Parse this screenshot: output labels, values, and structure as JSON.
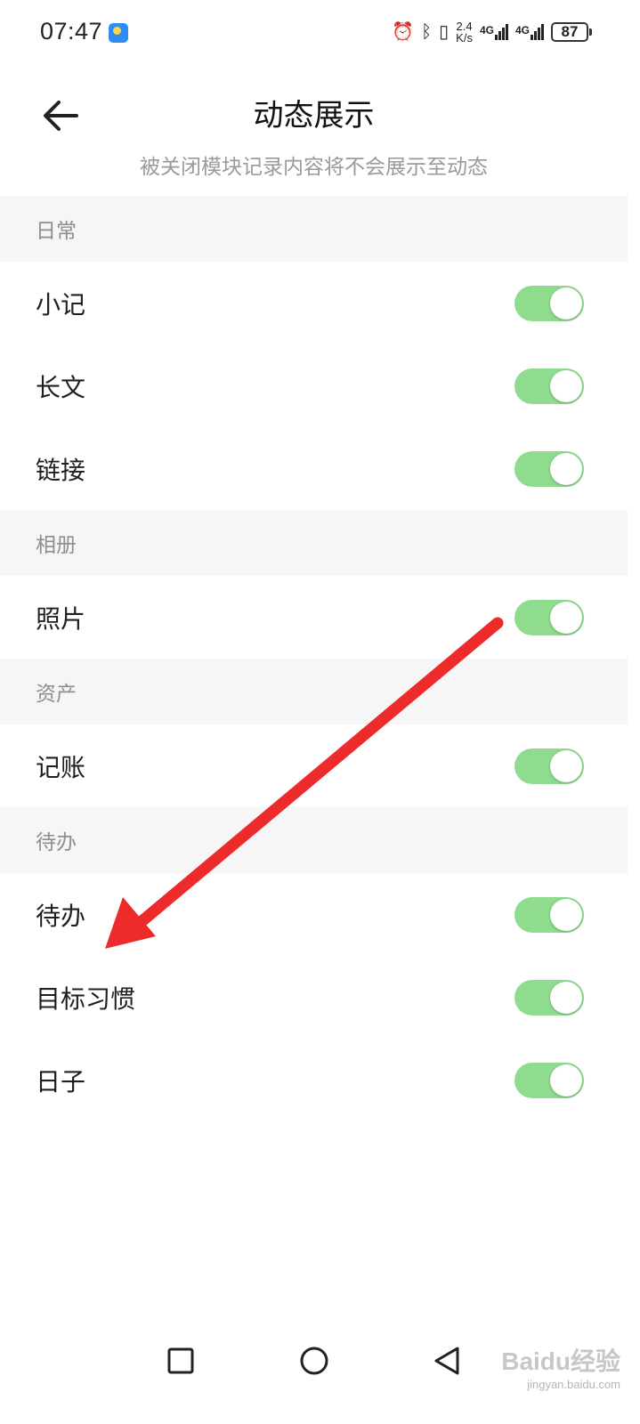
{
  "status_bar": {
    "time": "07:47",
    "speed_top": "2.4",
    "speed_bottom": "K/s",
    "sim1": "4G",
    "sim2": "4G",
    "battery": "87"
  },
  "header": {
    "title": "动态展示",
    "subtitle": "被关闭模块记录内容将不会展示至动态"
  },
  "sections": [
    {
      "title": "日常",
      "items": [
        {
          "label": "小记",
          "enabled": true
        },
        {
          "label": "长文",
          "enabled": true
        },
        {
          "label": "链接",
          "enabled": true
        }
      ]
    },
    {
      "title": "相册",
      "items": [
        {
          "label": "照片",
          "enabled": true
        }
      ]
    },
    {
      "title": "资产",
      "items": [
        {
          "label": "记账",
          "enabled": true
        }
      ]
    },
    {
      "title": "待办",
      "items": [
        {
          "label": "待办",
          "enabled": true
        },
        {
          "label": "目标习惯",
          "enabled": true
        },
        {
          "label": "日子",
          "enabled": true
        }
      ]
    }
  ],
  "colors": {
    "toggle_on": "#8fdc8f",
    "section_bg": "#f6f6f6",
    "annotation_arrow": "#ee2b2b"
  },
  "icons": {
    "back": "arrow-left-icon",
    "nav_recent": "square-icon",
    "nav_home": "circle-icon",
    "nav_back": "triangle-left-icon"
  },
  "watermark": {
    "logo": "Baidu经验",
    "url": "jingyan.baidu.com"
  }
}
